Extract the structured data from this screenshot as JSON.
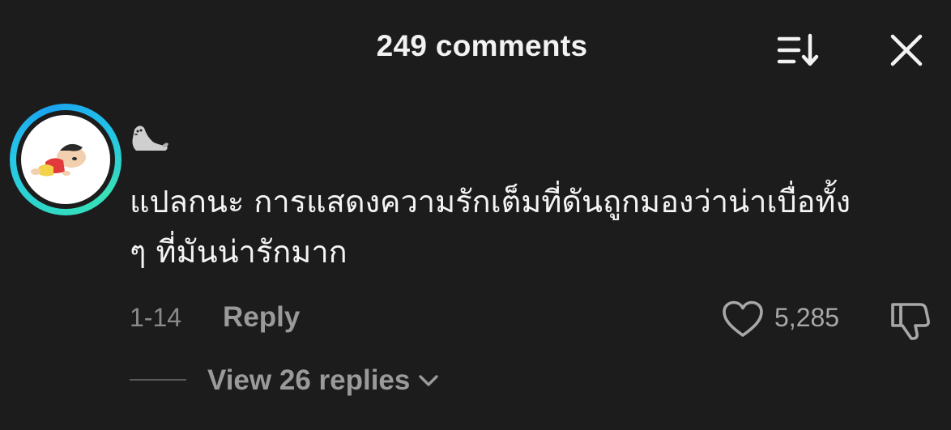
{
  "header": {
    "title": "249 comments",
    "sort_icon": "sort-descending-icon",
    "close_icon": "close-icon"
  },
  "comment": {
    "avatar": "avatar",
    "username_emoji": "seal-emoji",
    "text_line1": "แปลกนะ การแสดงความรักเต็มที่ดันถูกมองว่าน่าเบื่อทั้ง",
    "text_line2": "ๆ ที่มันน่ารักมาก",
    "date": "1-14",
    "reply_label": "Reply",
    "like_count": "5,285",
    "like_icon": "heart-icon",
    "dislike_icon": "thumbs-down-icon"
  },
  "replies": {
    "label": "View 26 replies",
    "chevron_icon": "chevron-down-icon"
  },
  "colors": {
    "background": "#1c1c1c",
    "ring_start": "#2fd8c6",
    "ring_end": "#1aa3f0",
    "muted_text": "#9a9a9a"
  }
}
